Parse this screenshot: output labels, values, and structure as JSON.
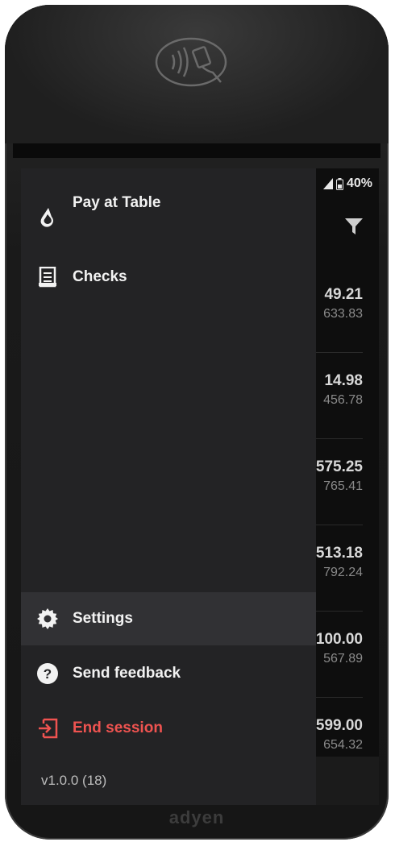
{
  "status": {
    "battery": "40%"
  },
  "background_list": [
    {
      "amount": "49.21",
      "sub": "633.83"
    },
    {
      "amount": "14.98",
      "sub": "456.78"
    },
    {
      "amount": "575.25",
      "sub": "765.41"
    },
    {
      "amount": "513.18",
      "sub": "792.24"
    },
    {
      "amount": "100.00",
      "sub": "567.89"
    },
    {
      "amount": "599.00",
      "sub": "654.32"
    }
  ],
  "drawer": {
    "items": [
      {
        "label": "Pay at Table",
        "icon": "lightspeed-flame-icon"
      },
      {
        "label": "Checks",
        "icon": "receipt-icon"
      }
    ],
    "bottom_items": [
      {
        "label": "Settings",
        "icon": "gear-icon",
        "active": true
      },
      {
        "label": "Send feedback",
        "icon": "help-circle-icon"
      },
      {
        "label": "End session",
        "icon": "logout-icon",
        "color": "#ef5350"
      }
    ],
    "version": "v1.0.0 (18)"
  },
  "device": {
    "brand": "adyen"
  }
}
